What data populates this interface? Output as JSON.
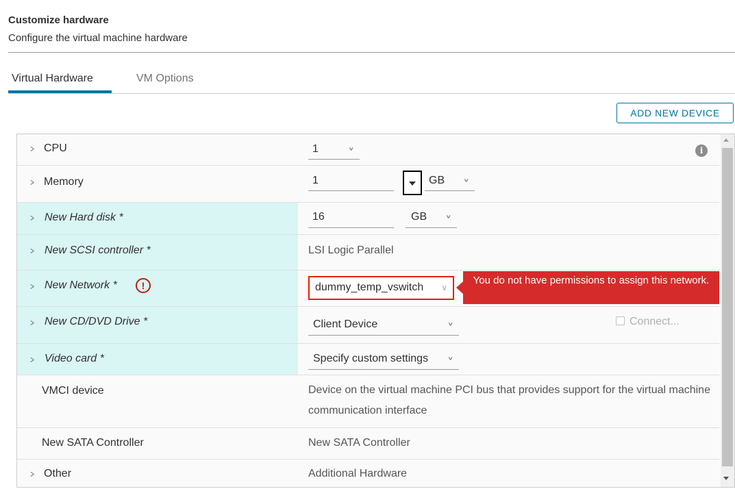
{
  "header": {
    "title": "Customize hardware",
    "subtitle": "Configure the virtual machine hardware"
  },
  "tabs": [
    {
      "label": "Virtual Hardware",
      "active": true
    },
    {
      "label": "VM Options",
      "active": false
    }
  ],
  "add_button": "ADD NEW DEVICE",
  "rows": {
    "cpu": {
      "label": "CPU",
      "value": "1"
    },
    "memory": {
      "label": "Memory",
      "value": "1",
      "unit": "GB"
    },
    "hard_disk": {
      "label": "New Hard disk *",
      "value": "16",
      "unit": "GB"
    },
    "scsi": {
      "label": "New SCSI controller *",
      "value": "LSI Logic Parallel"
    },
    "network": {
      "label": "New Network *",
      "value": "dummy_temp_vswitch",
      "error": "You do not have permissions to assign this network."
    },
    "cd_dvd": {
      "label": "New CD/DVD Drive *",
      "value": "Client Device",
      "connect_label": "Connect..."
    },
    "video": {
      "label": "Video card *",
      "value": "Specify custom settings"
    },
    "vmci": {
      "label": "VMCI device",
      "value": "Device on the virtual machine PCI bus that provides support for the virtual machine communication interface"
    },
    "sata": {
      "label": "New SATA Controller",
      "value": "New SATA Controller"
    },
    "other": {
      "label": "Other",
      "value": "Additional Hardware"
    }
  },
  "colors": {
    "accent": "#0072a3",
    "new_row_bg": "#d9f5f4",
    "error_red": "#d62b2b"
  },
  "icons": {
    "chevron": "chevron-right-icon",
    "caret": "chevron-down-icon",
    "info": "info-icon",
    "error": "error-exclamation-icon"
  }
}
